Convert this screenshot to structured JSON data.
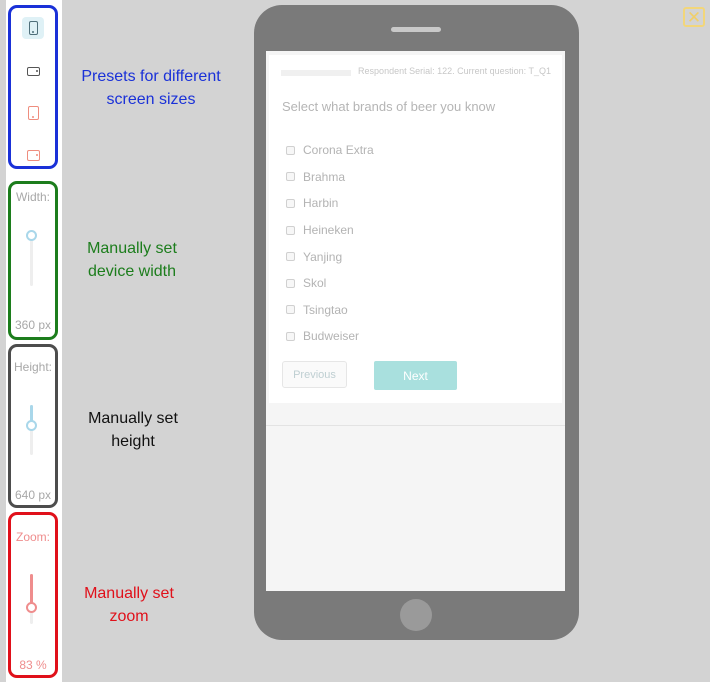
{
  "colors": {
    "presets_border": "#1a31d8",
    "width_border": "#1c7d1c",
    "height_border": "#4d4d4d",
    "zoom_border": "#e0101a",
    "next_button": "#a9e0de",
    "close_button": "#f2d67a",
    "slider_blue": "#a9d7ea",
    "slider_red": "#ef8d8d"
  },
  "presets": {
    "items": [
      {
        "icon": "phone-portrait-icon",
        "active": true
      },
      {
        "icon": "phone-landscape-icon",
        "active": false
      },
      {
        "icon": "tablet-portrait-icon",
        "active": false
      },
      {
        "icon": "tablet-landscape-icon",
        "active": false
      }
    ]
  },
  "width_slider": {
    "label": "Width:",
    "value": "360 px",
    "level": 0.0
  },
  "height_slider": {
    "label": "Height:",
    "value": "640 px",
    "level": 0.0
  },
  "zoom_slider": {
    "label": "Zoom:",
    "value": "83 %",
    "level": 0.83
  },
  "annotations": {
    "presets": "Presets for different screen sizes",
    "width": "Manually set device width",
    "height": "Manually set height",
    "zoom": "Manually set zoom"
  },
  "close_icon": "close-icon",
  "survey": {
    "respondent_info": "Respondent Serial: 122. Current question: T_Q1",
    "question": "Select what brands of beer you know",
    "options": [
      "Corona Extra",
      "Brahma",
      "Harbin",
      "Heineken",
      "Yanjing",
      "Skol",
      "Tsingtao",
      "Budweiser"
    ],
    "previous_label": "Previous",
    "next_label": "Next"
  }
}
